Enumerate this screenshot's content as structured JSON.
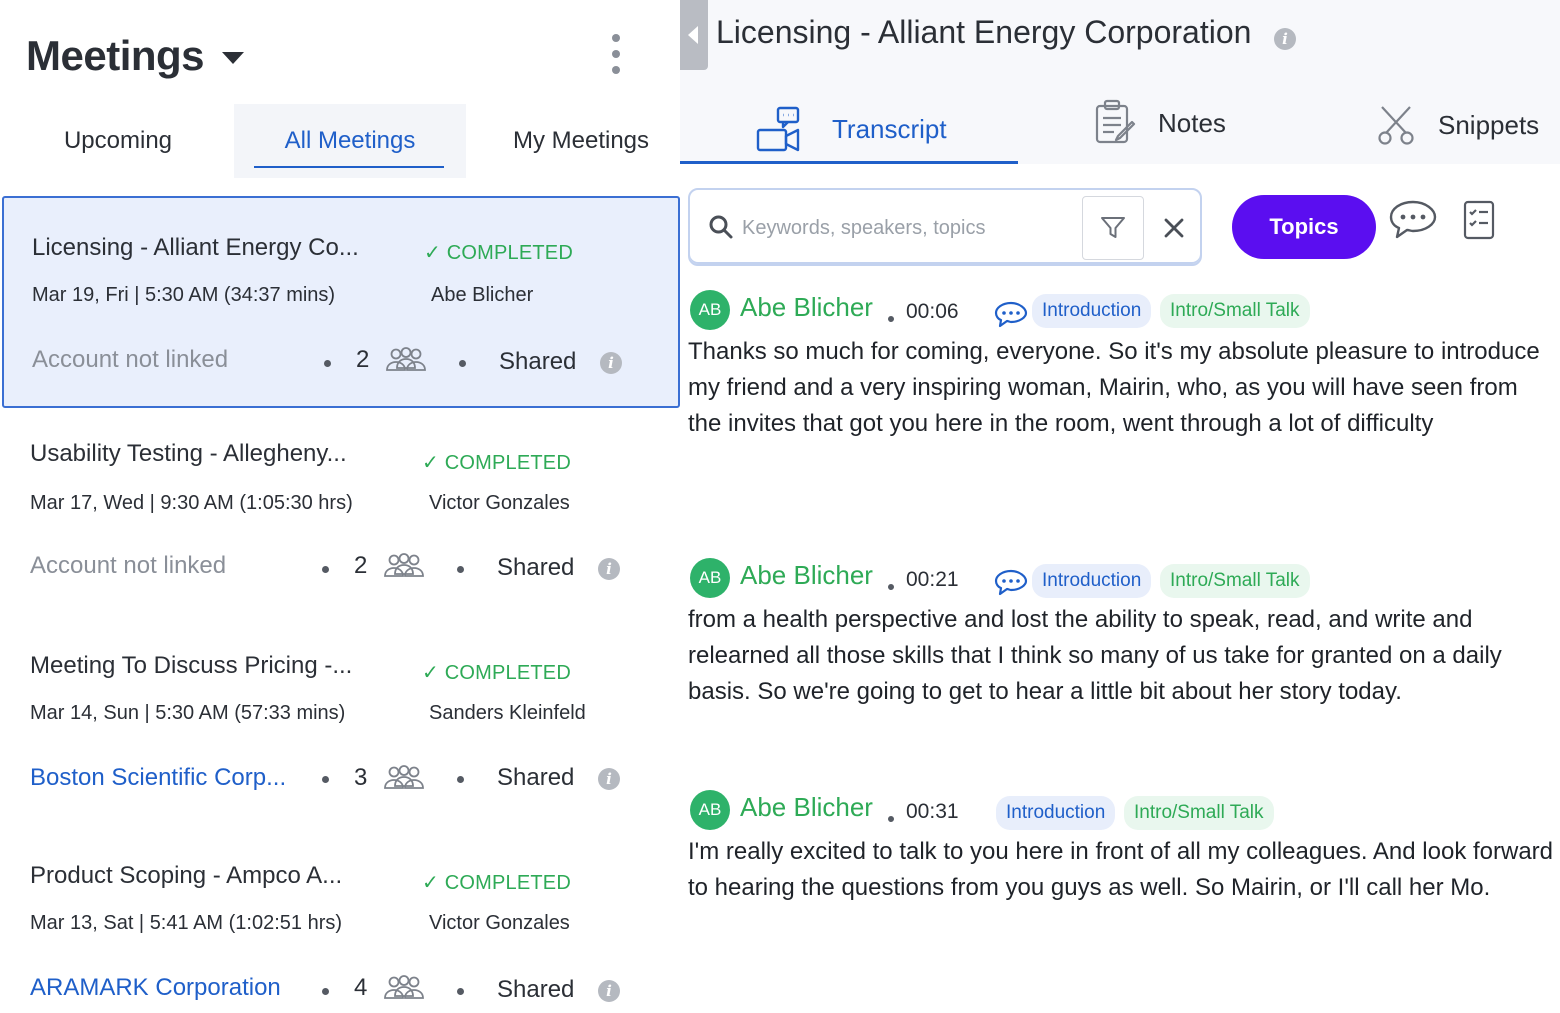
{
  "left": {
    "title": "Meetings",
    "tabs": [
      {
        "label": "Upcoming"
      },
      {
        "label": "All Meetings"
      },
      {
        "label": "My Meetings"
      }
    ],
    "meetings": [
      {
        "title": "Licensing - Alliant Energy Co...",
        "status": "COMPLETED",
        "date": "Mar 19, Fri | 5:30 AM (34:37 mins)",
        "owner": "Abe Blicher",
        "account": "Account not linked",
        "participants": "2",
        "visibility": "Shared"
      },
      {
        "title": "Usability Testing - Allegheny...",
        "status": "COMPLETED",
        "date": "Mar 17, Wed | 9:30 AM (1:05:30 hrs)",
        "owner": "Victor Gonzales",
        "account": "Account not linked",
        "participants": "2",
        "visibility": "Shared"
      },
      {
        "title": "Meeting To Discuss Pricing -...",
        "status": "COMPLETED",
        "date": "Mar 14, Sun | 5:30 AM (57:33 mins)",
        "owner": "Sanders Kleinfeld",
        "account": "Boston Scientific Corp...",
        "participants": "3",
        "visibility": "Shared"
      },
      {
        "title": "Product Scoping - Ampco A...",
        "status": "COMPLETED",
        "date": "Mar 13, Sat | 5:41 AM (1:02:51 hrs)",
        "owner": "Victor Gonzales",
        "account": "ARAMARK Corporation",
        "participants": "4",
        "visibility": "Shared"
      }
    ]
  },
  "right": {
    "title": "Licensing - Alliant Energy Corporation",
    "tabs": [
      {
        "label": "Transcript"
      },
      {
        "label": "Notes"
      },
      {
        "label": "Snippets"
      }
    ],
    "search": {
      "placeholder": "Keywords, speakers, topics"
    },
    "topics_label": "Topics",
    "transcript": [
      {
        "initials": "AB",
        "speaker": "Abe Blicher",
        "time": "00:06",
        "tags": [
          "Introduction",
          "Intro/Small Talk"
        ],
        "text": "Thanks so much for coming, everyone. So it's my absolute pleasure to introduce my friend and a very inspiring woman, Mairin, who, as you will have seen from the invites that got you here in the room, went through a lot of difficulty"
      },
      {
        "initials": "AB",
        "speaker": "Abe Blicher",
        "time": "00:21",
        "tags": [
          "Introduction",
          "Intro/Small Talk"
        ],
        "text": "from a health perspective and lost the ability to speak, read, and write and relearned all those skills that I think so many of us take for granted on a daily basis. So we're going to get to hear a little bit about her story today."
      },
      {
        "initials": "AB",
        "speaker": "Abe Blicher",
        "time": "00:31",
        "tags": [
          "Introduction",
          "Intro/Small Talk"
        ],
        "text": "I'm really excited to talk to you here in front of all my colleagues. And look forward to hearing the questions from you guys as well. So Mairin, or I'll call her Mo."
      }
    ]
  },
  "colors": {
    "accent_blue": "#1f5fc9",
    "completed_green": "#2eaa56",
    "topics_purple": "#5b0ef0",
    "selected_bg": "#e9effc"
  },
  "icons": [
    "chevron-down-icon",
    "kebab-menu-icon",
    "people-icon",
    "info-icon",
    "collapse-arrow-icon",
    "video-chat-icon",
    "notes-icon",
    "scissors-icon",
    "search-icon",
    "filter-icon",
    "close-icon",
    "comment-icon",
    "checklist-icon",
    "check-icon"
  ]
}
